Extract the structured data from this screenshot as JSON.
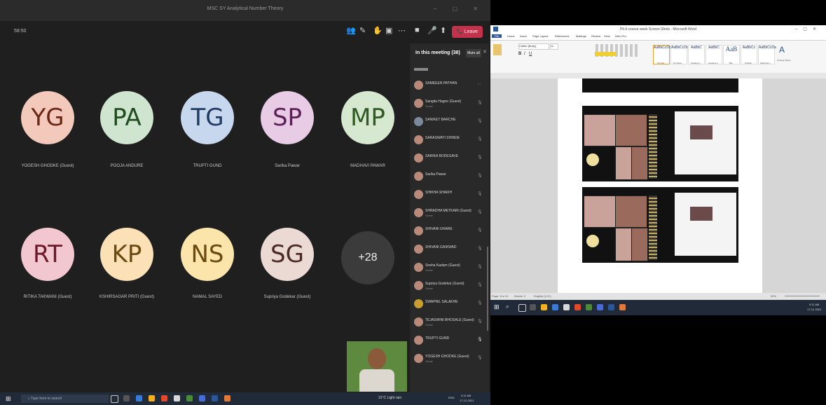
{
  "teams": {
    "window_title": "MSC SY Analytical Number Theory",
    "timer": "58:50",
    "leave_label": "Leave",
    "participants_title": "In this meeting (38)",
    "mute_all_label": "Mute all",
    "more_count": "+28",
    "tiles": [
      {
        "initials": "YG",
        "name": "YOGESH GHODKE (Guest)",
        "color": "#f2c9bb",
        "text_color": "#6b2616"
      },
      {
        "initials": "PA",
        "name": "POOJA ANDURE",
        "color": "#cfe5cf",
        "text_color": "#1f4d1f"
      },
      {
        "initials": "TG",
        "name": "TRUPTI GUND",
        "color": "#c7d8ee",
        "text_color": "#1f3b63"
      },
      {
        "initials": "SP",
        "name": "Sarika Pawar",
        "color": "#e8cce6",
        "text_color": "#5c1f57"
      },
      {
        "initials": "MP",
        "name": "MADHAVI PAWAR",
        "color": "#d6e8cf",
        "text_color": "#2f5a22"
      },
      {
        "initials": "RT",
        "name": "RITIKA TAKWANI (Guest)",
        "color": "#f3c7d0",
        "text_color": "#6a1a2a"
      },
      {
        "initials": "KP",
        "name": "KSHIRSAGAR PRITI (Guest)",
        "color": "#fbe1b5",
        "text_color": "#6a4a10"
      },
      {
        "initials": "NS",
        "name": "NAMAL SAYED",
        "color": "#fbe5ab",
        "text_color": "#6a4a10"
      },
      {
        "initials": "SG",
        "name": "Supriya Godekar (Guest)",
        "color": "#eadad3",
        "text_color": "#4a2a22"
      }
    ],
    "participants": [
      {
        "name": "SAMEEEN PATHAN",
        "guest": ""
      },
      {
        "name": "Sangita Hagne (Guest)",
        "guest": "Guest"
      },
      {
        "name": "SANIKET BARCHE",
        "guest": ""
      },
      {
        "name": "SARASWATI SHINDE",
        "guest": ""
      },
      {
        "name": "SARIKA BODEGAVE",
        "guest": ""
      },
      {
        "name": "Sarika Pawar",
        "guest": ""
      },
      {
        "name": "SHIKHA SHAIKH",
        "guest": ""
      },
      {
        "name": "SHRADHA METKARI (Guest)",
        "guest": "Guest"
      },
      {
        "name": "SHIVANI GHARE",
        "guest": ""
      },
      {
        "name": "SHIVANI GAIKWAD",
        "guest": ""
      },
      {
        "name": "Sneha Kadam (Guest)",
        "guest": "Guest"
      },
      {
        "name": "Supriya Godekar (Guest)",
        "guest": "Guest"
      },
      {
        "name": "SWAPNIL SALAKHE",
        "guest": ""
      },
      {
        "name": "TEJASWINI BHOSALE (Guest)",
        "guest": "Guest"
      },
      {
        "name": "TRUPTI GUND",
        "guest": ""
      },
      {
        "name": "YOGESH GHODKE (Guest)",
        "guest": "Guest"
      }
    ]
  },
  "taskbar_left": {
    "search_placeholder": "Type here to search",
    "weather": "31°C Light rain",
    "lang": "ENG",
    "time": "9:11 AM",
    "date": "17-12-2021"
  },
  "word": {
    "title": "Pit d course week Screen Shots - Microsoft Word",
    "tabs": [
      "File",
      "Home",
      "Insert",
      "Page Layout",
      "References",
      "Mailings",
      "Review",
      "View",
      "Nitro Pro"
    ],
    "font": "Calibri (Body)",
    "size": "11",
    "styles": [
      {
        "label": "Normal",
        "preview": "AaBbCcDc"
      },
      {
        "label": "No Spaci...",
        "preview": "AaBbCcDc"
      },
      {
        "label": "Heading 1",
        "preview": "AaBbC"
      },
      {
        "label": "Heading 2",
        "preview": "AaBbC"
      },
      {
        "label": "Title",
        "preview": "AaB"
      },
      {
        "label": "Subtitle",
        "preview": "AaBbCc"
      },
      {
        "label": "Subtle Em...",
        "preview": "AaBbCcDa"
      }
    ],
    "change_styles": "Change Styles",
    "status_page": "Page: 8 of 11",
    "status_words": "Words: 0",
    "status_lang": "English (U.S.)",
    "zoom": "50%"
  },
  "taskbar_right": {
    "time": "9:11 AM",
    "date": "17-12-2021"
  }
}
